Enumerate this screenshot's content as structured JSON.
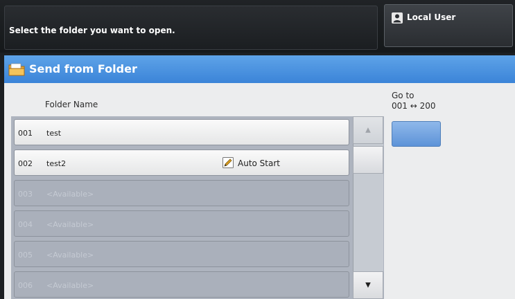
{
  "topbar": {
    "message": "Select the folder you want to open.",
    "user_label": "Local User",
    "user_icon": "user-icon"
  },
  "panel": {
    "title": "Send from Folder",
    "title_icon": "folder-icon",
    "accent_color": "#3b84d8",
    "column_header": "Folder Name",
    "goto_title": "Go to",
    "goto_range": "001 ↔ 200",
    "goto_value": ""
  },
  "folders": [
    {
      "num": "001",
      "name": "test",
      "auto_start": ""
    },
    {
      "num": "002",
      "name": "test2",
      "auto_start": "Auto Start"
    },
    {
      "num": "003",
      "name": "<Available>",
      "auto_start": ""
    },
    {
      "num": "004",
      "name": "<Available>",
      "auto_start": ""
    },
    {
      "num": "005",
      "name": "<Available>",
      "auto_start": ""
    },
    {
      "num": "006",
      "name": "<Available>",
      "auto_start": ""
    }
  ],
  "scroll": {
    "up_icon": "triangle-up-icon",
    "down_icon": "triangle-down-icon"
  }
}
